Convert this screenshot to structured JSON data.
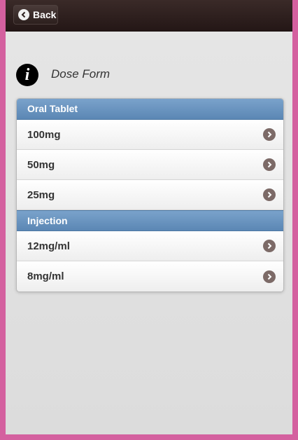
{
  "header": {
    "back_label": "Back"
  },
  "page": {
    "title": "Dose Form",
    "info_icon": "info-icon"
  },
  "groups": [
    {
      "label": "Oral Tablet",
      "items": [
        "100mg",
        "50mg",
        "25mg"
      ]
    },
    {
      "label": "Injection",
      "items": [
        "12mg/ml",
        "8mg/ml"
      ]
    }
  ],
  "colors": {
    "frame_border": "#d4609f",
    "header_bg": "#2c1f1d",
    "divider_bg": "#6b94bf",
    "arrow_icon": "#7c6a67"
  }
}
